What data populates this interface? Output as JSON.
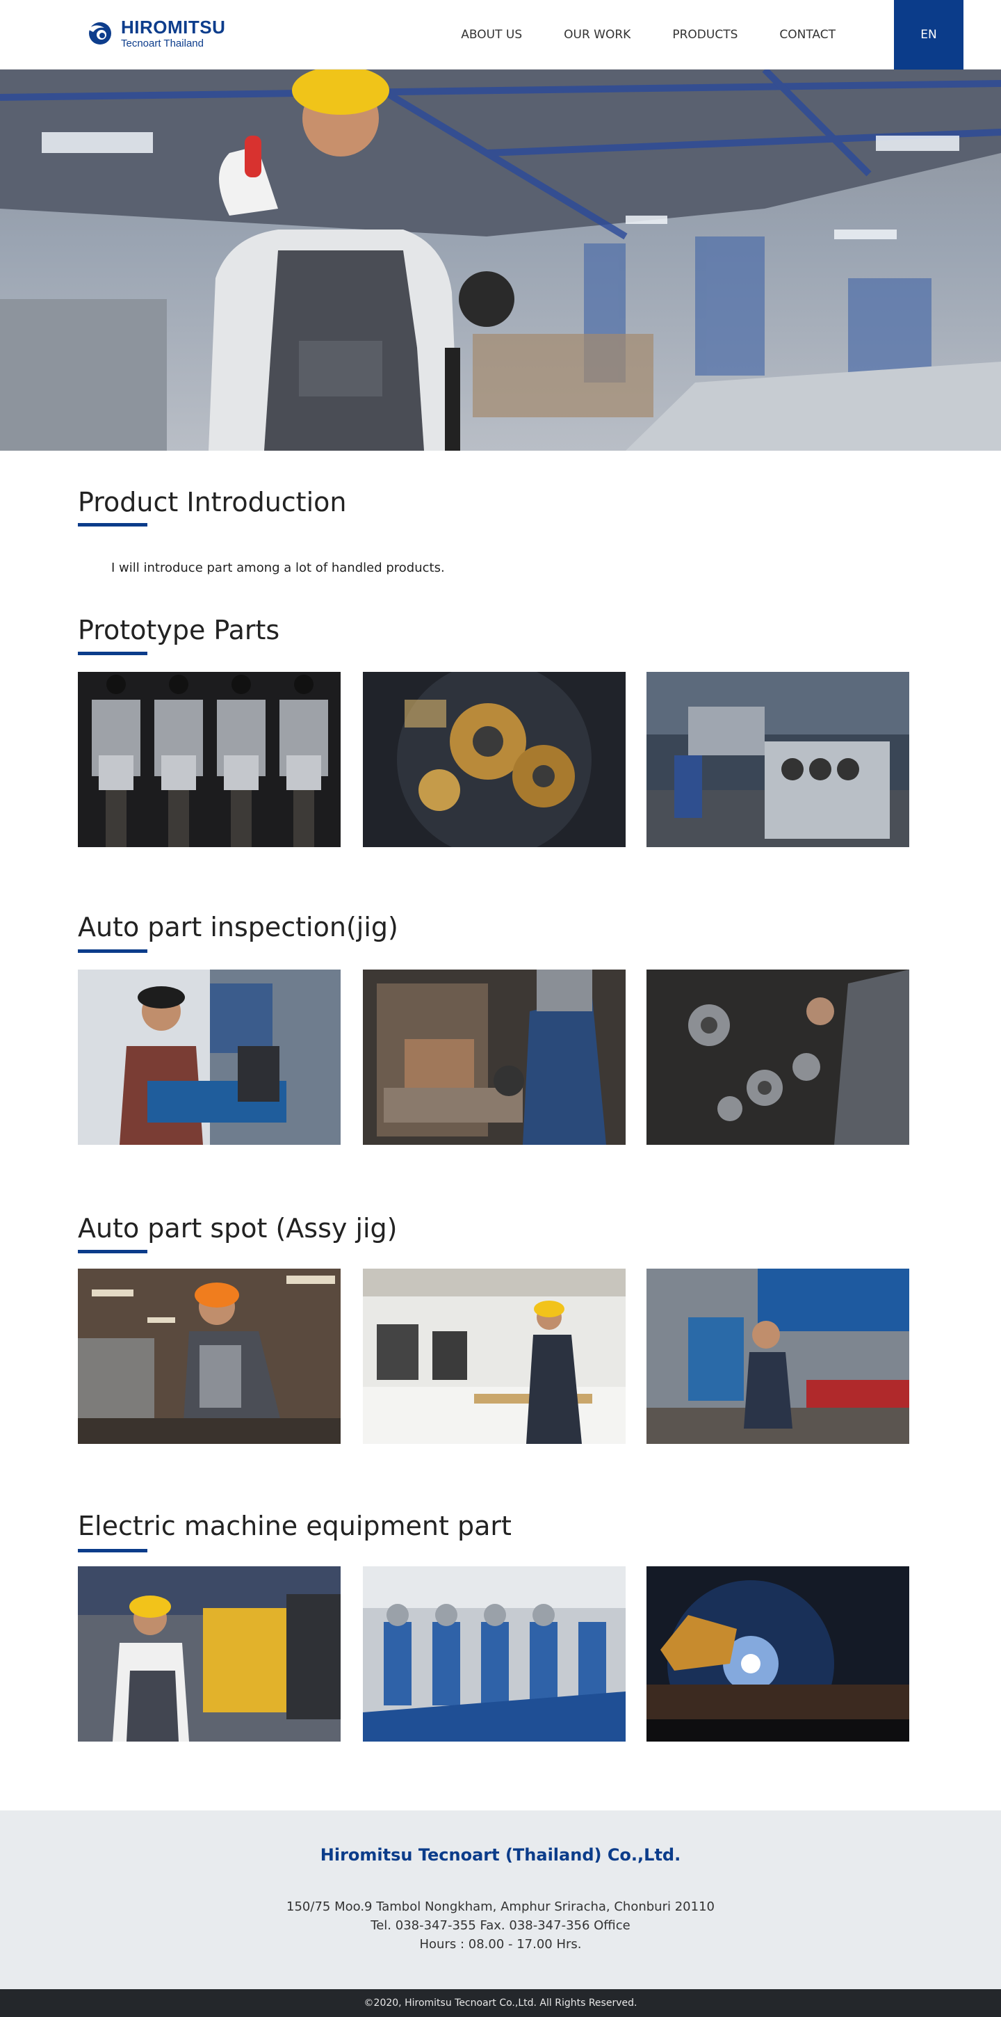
{
  "header": {
    "logo_name": "HIROMITSU",
    "logo_sub": "Tecnoart Thailand",
    "nav": [
      "ABOUT US",
      "OUR WORK",
      "PRODUCTS",
      "CONTACT"
    ],
    "lang": "EN"
  },
  "intro": {
    "title": "Product Introduction",
    "text": "I will introduce part among a lot of handled products."
  },
  "sections": [
    {
      "title": "Prototype Parts"
    },
    {
      "title": "Auto part inspection(jig)"
    },
    {
      "title": "Auto part spot (Assy jig)"
    },
    {
      "title": "Electric machine equipment part"
    }
  ],
  "footer": {
    "company": "Hiromitsu Tecnoart (Thailand) Co.,Ltd.",
    "address": "150/75 Moo.9 Tambol Nongkham, Amphur Sriracha, Chonburi 20110",
    "phone": "Tel. 038-347-355  Fax. 038-347-356 Office",
    "hours": "Hours : 08.00 - 17.00 Hrs.",
    "copyright": "©2020, Hiromitsu Tecnoart Co.,Ltd. All Rights Reserved."
  },
  "colors": {
    "brand": "#0b3c8a",
    "footer_bg": "#e8ebee",
    "copyright_bg": "#24272b"
  }
}
